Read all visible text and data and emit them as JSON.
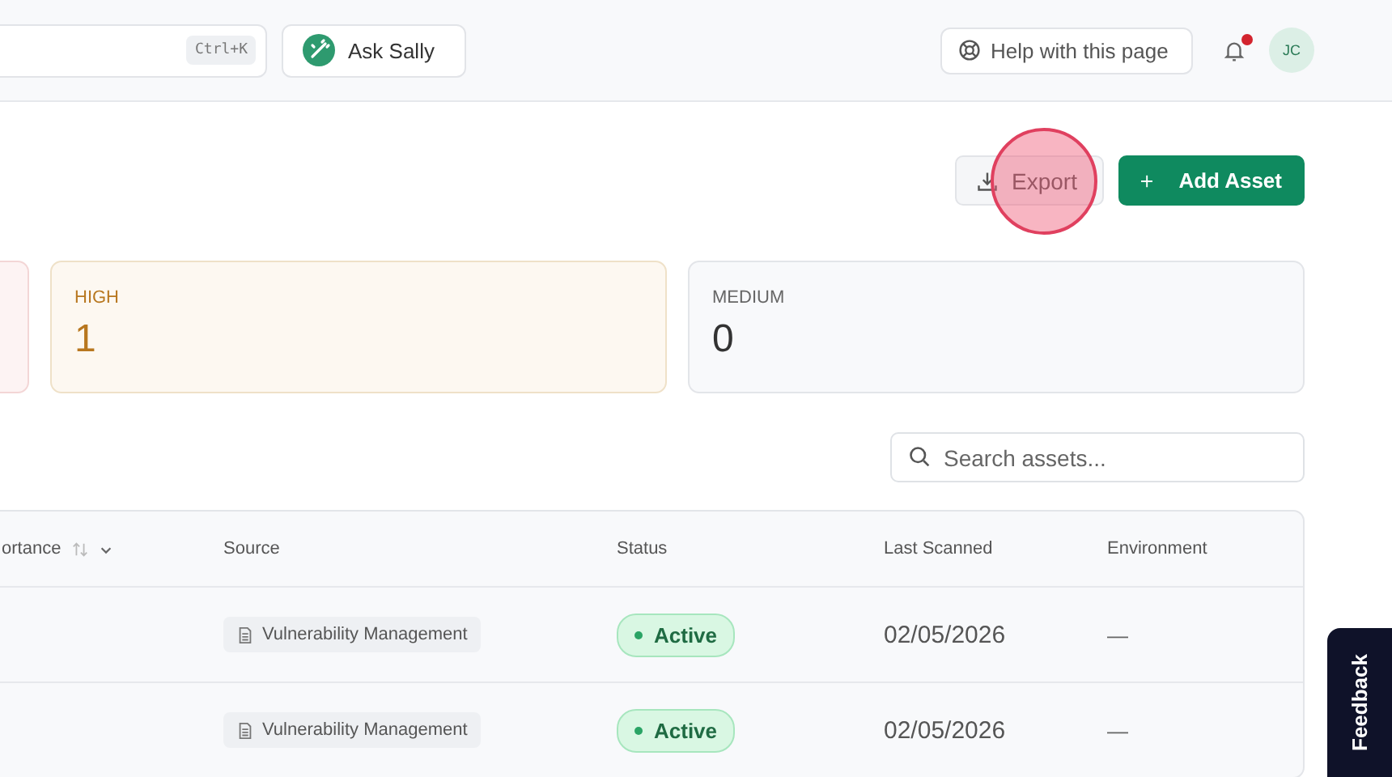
{
  "header": {
    "search": {
      "shortcut": "Ctrl+K"
    },
    "ask_button": "Ask Sally",
    "help_button": "Help with this page",
    "notifications": {
      "unread": true
    },
    "avatar": "JC"
  },
  "actions": {
    "export": {
      "label": "Export",
      "clicked": true
    },
    "add": {
      "label": "Add Asset"
    }
  },
  "summary_cards": [
    {
      "kind": "critical"
    },
    {
      "kind": "high",
      "label": "HIGH",
      "count": "1"
    },
    {
      "kind": "medium",
      "label": "MEDIUM",
      "count": "0"
    }
  ],
  "search": {
    "placeholder": "Search assets..."
  },
  "table": {
    "columns": [
      {
        "label": "ortance",
        "sortable": true
      },
      {
        "label": "Source",
        "sortable": false
      },
      {
        "label": "Status",
        "sortable": false
      },
      {
        "label": "Last Scanned",
        "sortable": false
      },
      {
        "label": "Environment",
        "sortable": false
      }
    ],
    "rows": [
      {
        "source": "Vulnerability Management",
        "status": {
          "kind": "active",
          "label": "Active"
        },
        "last_scanned": "02/05/2026",
        "environment": "—"
      },
      {
        "source": "Vulnerability Management",
        "status": {
          "kind": "active",
          "label": "Active"
        },
        "last_scanned": "02/05/2026",
        "environment": "—"
      }
    ]
  },
  "feedback": "Feedback"
}
